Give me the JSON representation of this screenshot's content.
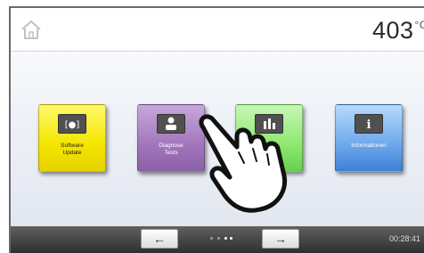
{
  "header": {
    "temperature": "403",
    "temperature_unit": "°C"
  },
  "tiles": [
    {
      "label": "Software\nUpdate",
      "color": "#f4e600",
      "icon": "update-icon"
    },
    {
      "label": "Diagnose\nTests",
      "color": "#a276bd",
      "icon": "diagnose-icon"
    },
    {
      "label": "",
      "color": "#8fe86f",
      "icon": "monitor-icon"
    },
    {
      "label": "Informationen",
      "color": "#6ea8ec",
      "icon": "info-icon"
    }
  ],
  "footer": {
    "prev_label": "←",
    "next_label": "→",
    "time": "00:28:41"
  },
  "overlay": {
    "icon": "pointing-hand-icon"
  }
}
